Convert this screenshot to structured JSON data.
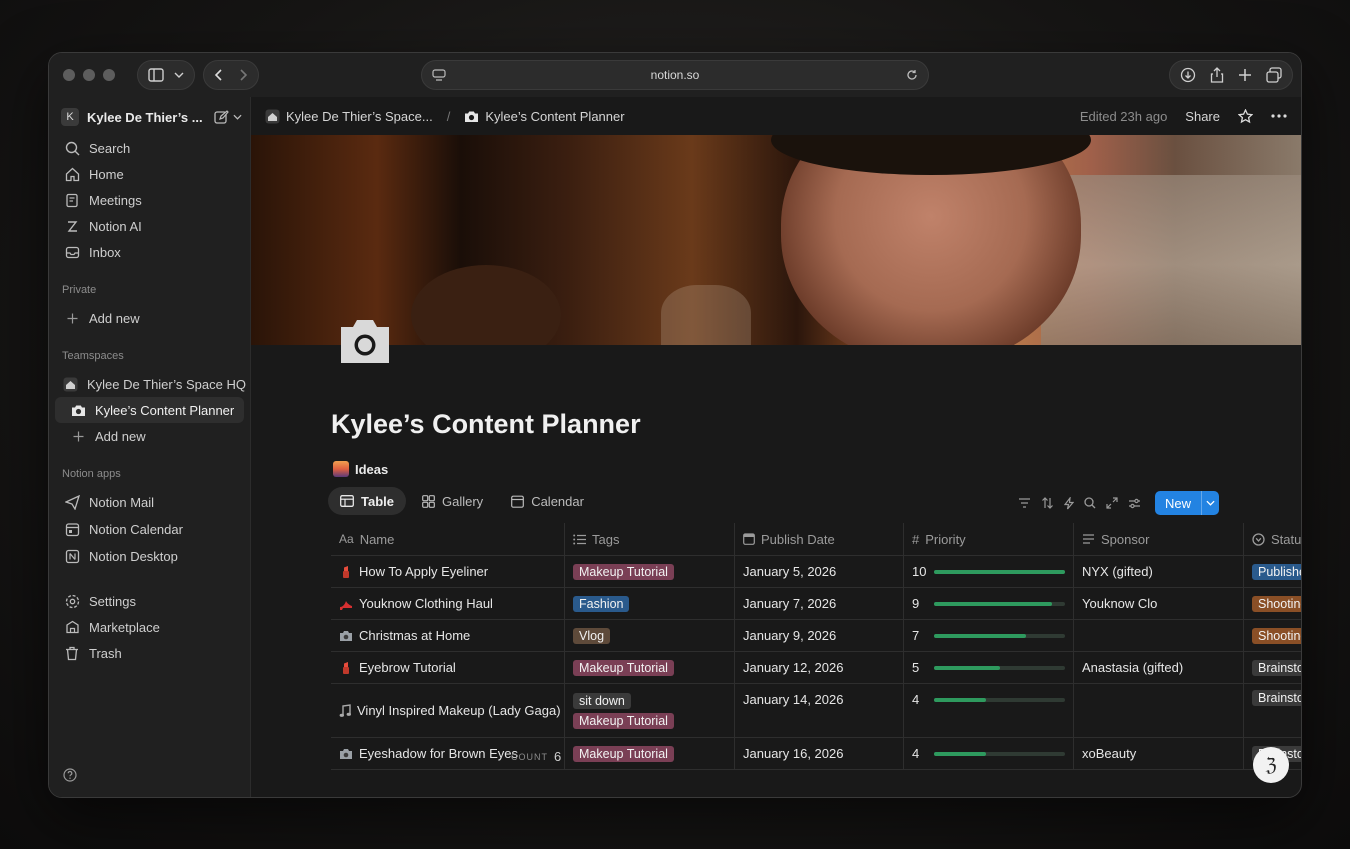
{
  "browser": {
    "url": "notion.so"
  },
  "sidebar": {
    "workspace_initial": "K",
    "workspace_name": "Kylee De Thier’s ...",
    "nav": [
      {
        "label": "Search",
        "icon": "search-icon"
      },
      {
        "label": "Home",
        "icon": "home-icon"
      },
      {
        "label": "Meetings",
        "icon": "meetings-icon"
      },
      {
        "label": "Notion AI",
        "icon": "notion-ai-icon"
      },
      {
        "label": "Inbox",
        "icon": "inbox-icon"
      }
    ],
    "private_label": "Private",
    "private_add": "Add new",
    "teamspaces_label": "Teamspaces",
    "teamspace": "Kylee De Thier’s Space HQ",
    "active_page": "Kylee’s Content Planner",
    "teamspace_add": "Add new",
    "apps_label": "Notion apps",
    "apps": [
      {
        "label": "Notion Mail",
        "icon": "mail-icon"
      },
      {
        "label": "Notion Calendar",
        "icon": "calendar-icon"
      },
      {
        "label": "Notion Desktop",
        "icon": "desktop-icon"
      }
    ],
    "bottom": [
      {
        "label": "Settings",
        "icon": "gear-icon"
      },
      {
        "label": "Marketplace",
        "icon": "marketplace-icon"
      },
      {
        "label": "Trash",
        "icon": "trash-icon"
      }
    ]
  },
  "topbar": {
    "crumb_space": "Kylee De Thier’s Space...",
    "crumb_page": "Kylee’s Content Planner",
    "edited": "Edited 23h ago",
    "share": "Share"
  },
  "page": {
    "title": "Kylee’s Content Planner",
    "linked_db": "Ideas",
    "views": [
      "Table",
      "Gallery",
      "Calendar"
    ],
    "new_label": "New",
    "count_label": "COUNT",
    "count_value": "6"
  },
  "table": {
    "headers": {
      "name": "Name",
      "tags": "Tags",
      "date": "Publish Date",
      "priority": "Priority",
      "sponsor": "Sponsor",
      "status": "Status"
    },
    "rows": [
      {
        "name": "How To Apply Eyeliner",
        "emoji": "lipstick",
        "tags": [
          "Makeup Tutorial"
        ],
        "date": "January 5, 2026",
        "priority": "10",
        "priority_level": 1.0,
        "sponsor": "NYX (gifted)",
        "status": "Published",
        "status_color": "blue"
      },
      {
        "name": "Youknow Clothing Haul",
        "emoji": "heel",
        "tags": [
          "Fashion"
        ],
        "date": "January 7, 2026",
        "priority": "9",
        "priority_level": 0.9,
        "sponsor": "Youknow Clo",
        "status": "Shooting",
        "status_color": "orange"
      },
      {
        "name": "Christmas at Home",
        "emoji": "camera",
        "tags": [
          "Vlog"
        ],
        "date": "January 9, 2026",
        "priority": "7",
        "priority_level": 0.7,
        "sponsor": "",
        "status": "Shooting",
        "status_color": "orange"
      },
      {
        "name": "Eyebrow Tutorial",
        "emoji": "lipstick",
        "tags": [
          "Makeup Tutorial"
        ],
        "date": "January 12, 2026",
        "priority": "5",
        "priority_level": 0.5,
        "sponsor": "Anastasia (gifted)",
        "status": "Brainstorm",
        "status_color": "gray"
      },
      {
        "name": "Vinyl Inspired Makeup (Lady Gaga)",
        "emoji": "note",
        "tags": [
          "sit down",
          "Makeup Tutorial"
        ],
        "date": "January 14, 2026",
        "priority": "4",
        "priority_level": 0.4,
        "sponsor": "",
        "status": "Brainstorm",
        "status_color": "gray"
      },
      {
        "name": "Eyeshadow for Brown Eyes",
        "emoji": "camera",
        "tags": [
          "Makeup Tutorial"
        ],
        "date": "January 16, 2026",
        "priority": "4",
        "priority_level": 0.4,
        "sponsor": "xoBeauty",
        "status": "Brainstorm",
        "status_color": "gray"
      }
    ]
  },
  "colors": {
    "accent": "#2383e2",
    "priority_bar": "#2e9a5e",
    "background": "#191919",
    "sidebar": "#202020"
  }
}
